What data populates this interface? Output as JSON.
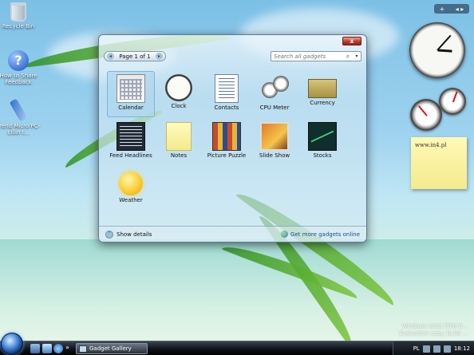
{
  "desktop": {
    "icons": [
      {
        "label": "Recycle Bin"
      },
      {
        "label": "How to Share Feedback"
      },
      {
        "label": "Trend Micro PC-cillin I..."
      }
    ]
  },
  "sidebar": {
    "add_symbol": "+",
    "nav_symbol": "◂ ▸"
  },
  "gadgets": {
    "clock": {
      "hour": 3,
      "minute": 7
    },
    "notes": {
      "text": "www.in4.pl"
    }
  },
  "gallery": {
    "close_symbol": "x",
    "pager": {
      "label": "Page 1 of 1",
      "prev": "◂",
      "next": "▸"
    },
    "search": {
      "placeholder": "Search all gadgets",
      "icon": "search-icon"
    },
    "items": [
      {
        "label": "Calendar",
        "selected": true
      },
      {
        "label": "Clock"
      },
      {
        "label": "Contacts"
      },
      {
        "label": "CPU Meter"
      },
      {
        "label": "Currency"
      },
      {
        "label": "Feed Headlines"
      },
      {
        "label": "Notes"
      },
      {
        "label": "Picture Puzzle"
      },
      {
        "label": "Slide Show"
      },
      {
        "label": "Stocks"
      },
      {
        "label": "Weather"
      }
    ],
    "footer": {
      "show_details": "Show details",
      "more_gadgets": "Get more gadgets online"
    }
  },
  "watermark": {
    "line1": "Windows Vista (TM) B...",
    "line2": "Evaluation copy. Build ..."
  },
  "taskbar": {
    "active_window": "Gadget Gallery",
    "chevron": "»",
    "language": "PL",
    "time": "18:12"
  },
  "colors": {
    "accent": "#3a7fd5",
    "close": "#c1392b",
    "notes": "#fff9b6"
  }
}
